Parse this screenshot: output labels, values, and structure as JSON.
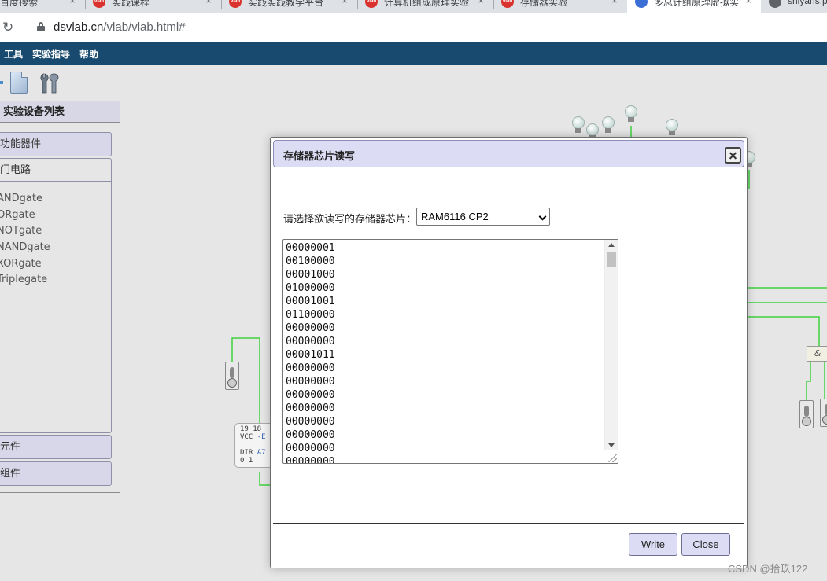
{
  "browser": {
    "tabs": [
      {
        "title": "百度搜索",
        "favicon": "circle"
      },
      {
        "title": "实践课程",
        "favicon": "vlab-logo"
      },
      {
        "title": "实践实践教学平台",
        "favicon": "vlab-logo"
      },
      {
        "title": "计算机组成原理实验",
        "favicon": "vlab-logo"
      },
      {
        "title": "存储器实验",
        "favicon": "vlab-logo"
      },
      {
        "title": "多总计组原理虚拟实",
        "favicon": "blue-circle",
        "active": true
      },
      {
        "title": "shiyans.p",
        "favicon": "globe"
      }
    ],
    "tab_close": "×",
    "reload_icon": "↻",
    "url_host": "dsvlab.cn",
    "url_path": "/vlab/vlab.html#"
  },
  "menubar": {
    "items": [
      "工具",
      "实验指导",
      "帮助"
    ],
    "background": "#174a6e"
  },
  "sidebar": {
    "title": "实验设备列表",
    "func_devices": "功能器件",
    "gate_circuit": "门电路",
    "gates": [
      "ANDgate",
      "ORgate",
      "NOTgate",
      "NANDgate",
      "XORgate",
      "Triplegate"
    ],
    "components": "元件",
    "assemblies": "组件"
  },
  "canvas": {
    "chip_pins_top": "19  18",
    "chip_pins_label": "VCC",
    "chip_pin_e": "-E",
    "chip_dir": "DIR",
    "chip_a7": "A7",
    "chip_pins_bottom": "0   1",
    "and_gate_symbol": "&"
  },
  "dialog": {
    "title": "存储器芯片读写",
    "select_label": "请选择欲读写的存储器芯片：",
    "selected_chip": "RAM6116 CP2",
    "memory_lines": [
      "00000001",
      "00100000",
      "00001000",
      "01000000",
      "00001001",
      "01100000",
      "00000000",
      "00000000",
      "00001011",
      "00000000",
      "00000000",
      "00000000",
      "00000000",
      "00000000",
      "00000000",
      "00000000",
      "00000000"
    ],
    "write_label": "Write",
    "close_label": "Close"
  },
  "watermark": "CSDN @拾玖122"
}
